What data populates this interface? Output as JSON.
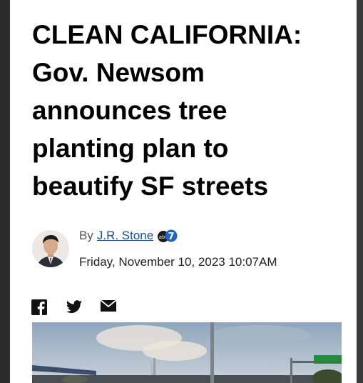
{
  "article": {
    "headline_lines": [
      "CLEAN CALIFORNIA:",
      "Gov. Newsom",
      "announces tree",
      "planting plan to",
      "beautify SF streets"
    ],
    "byline_prefix": "By",
    "author": "J.R. Stone",
    "station_logo": "abc7-logo",
    "date": "Friday, November 10, 2023 10:07AM"
  },
  "share": {
    "icons": [
      "facebook-icon",
      "twitter-icon",
      "email-icon"
    ]
  },
  "colors": {
    "author_link": "#1d4fa0",
    "sign_green": "#1f8f3a"
  }
}
